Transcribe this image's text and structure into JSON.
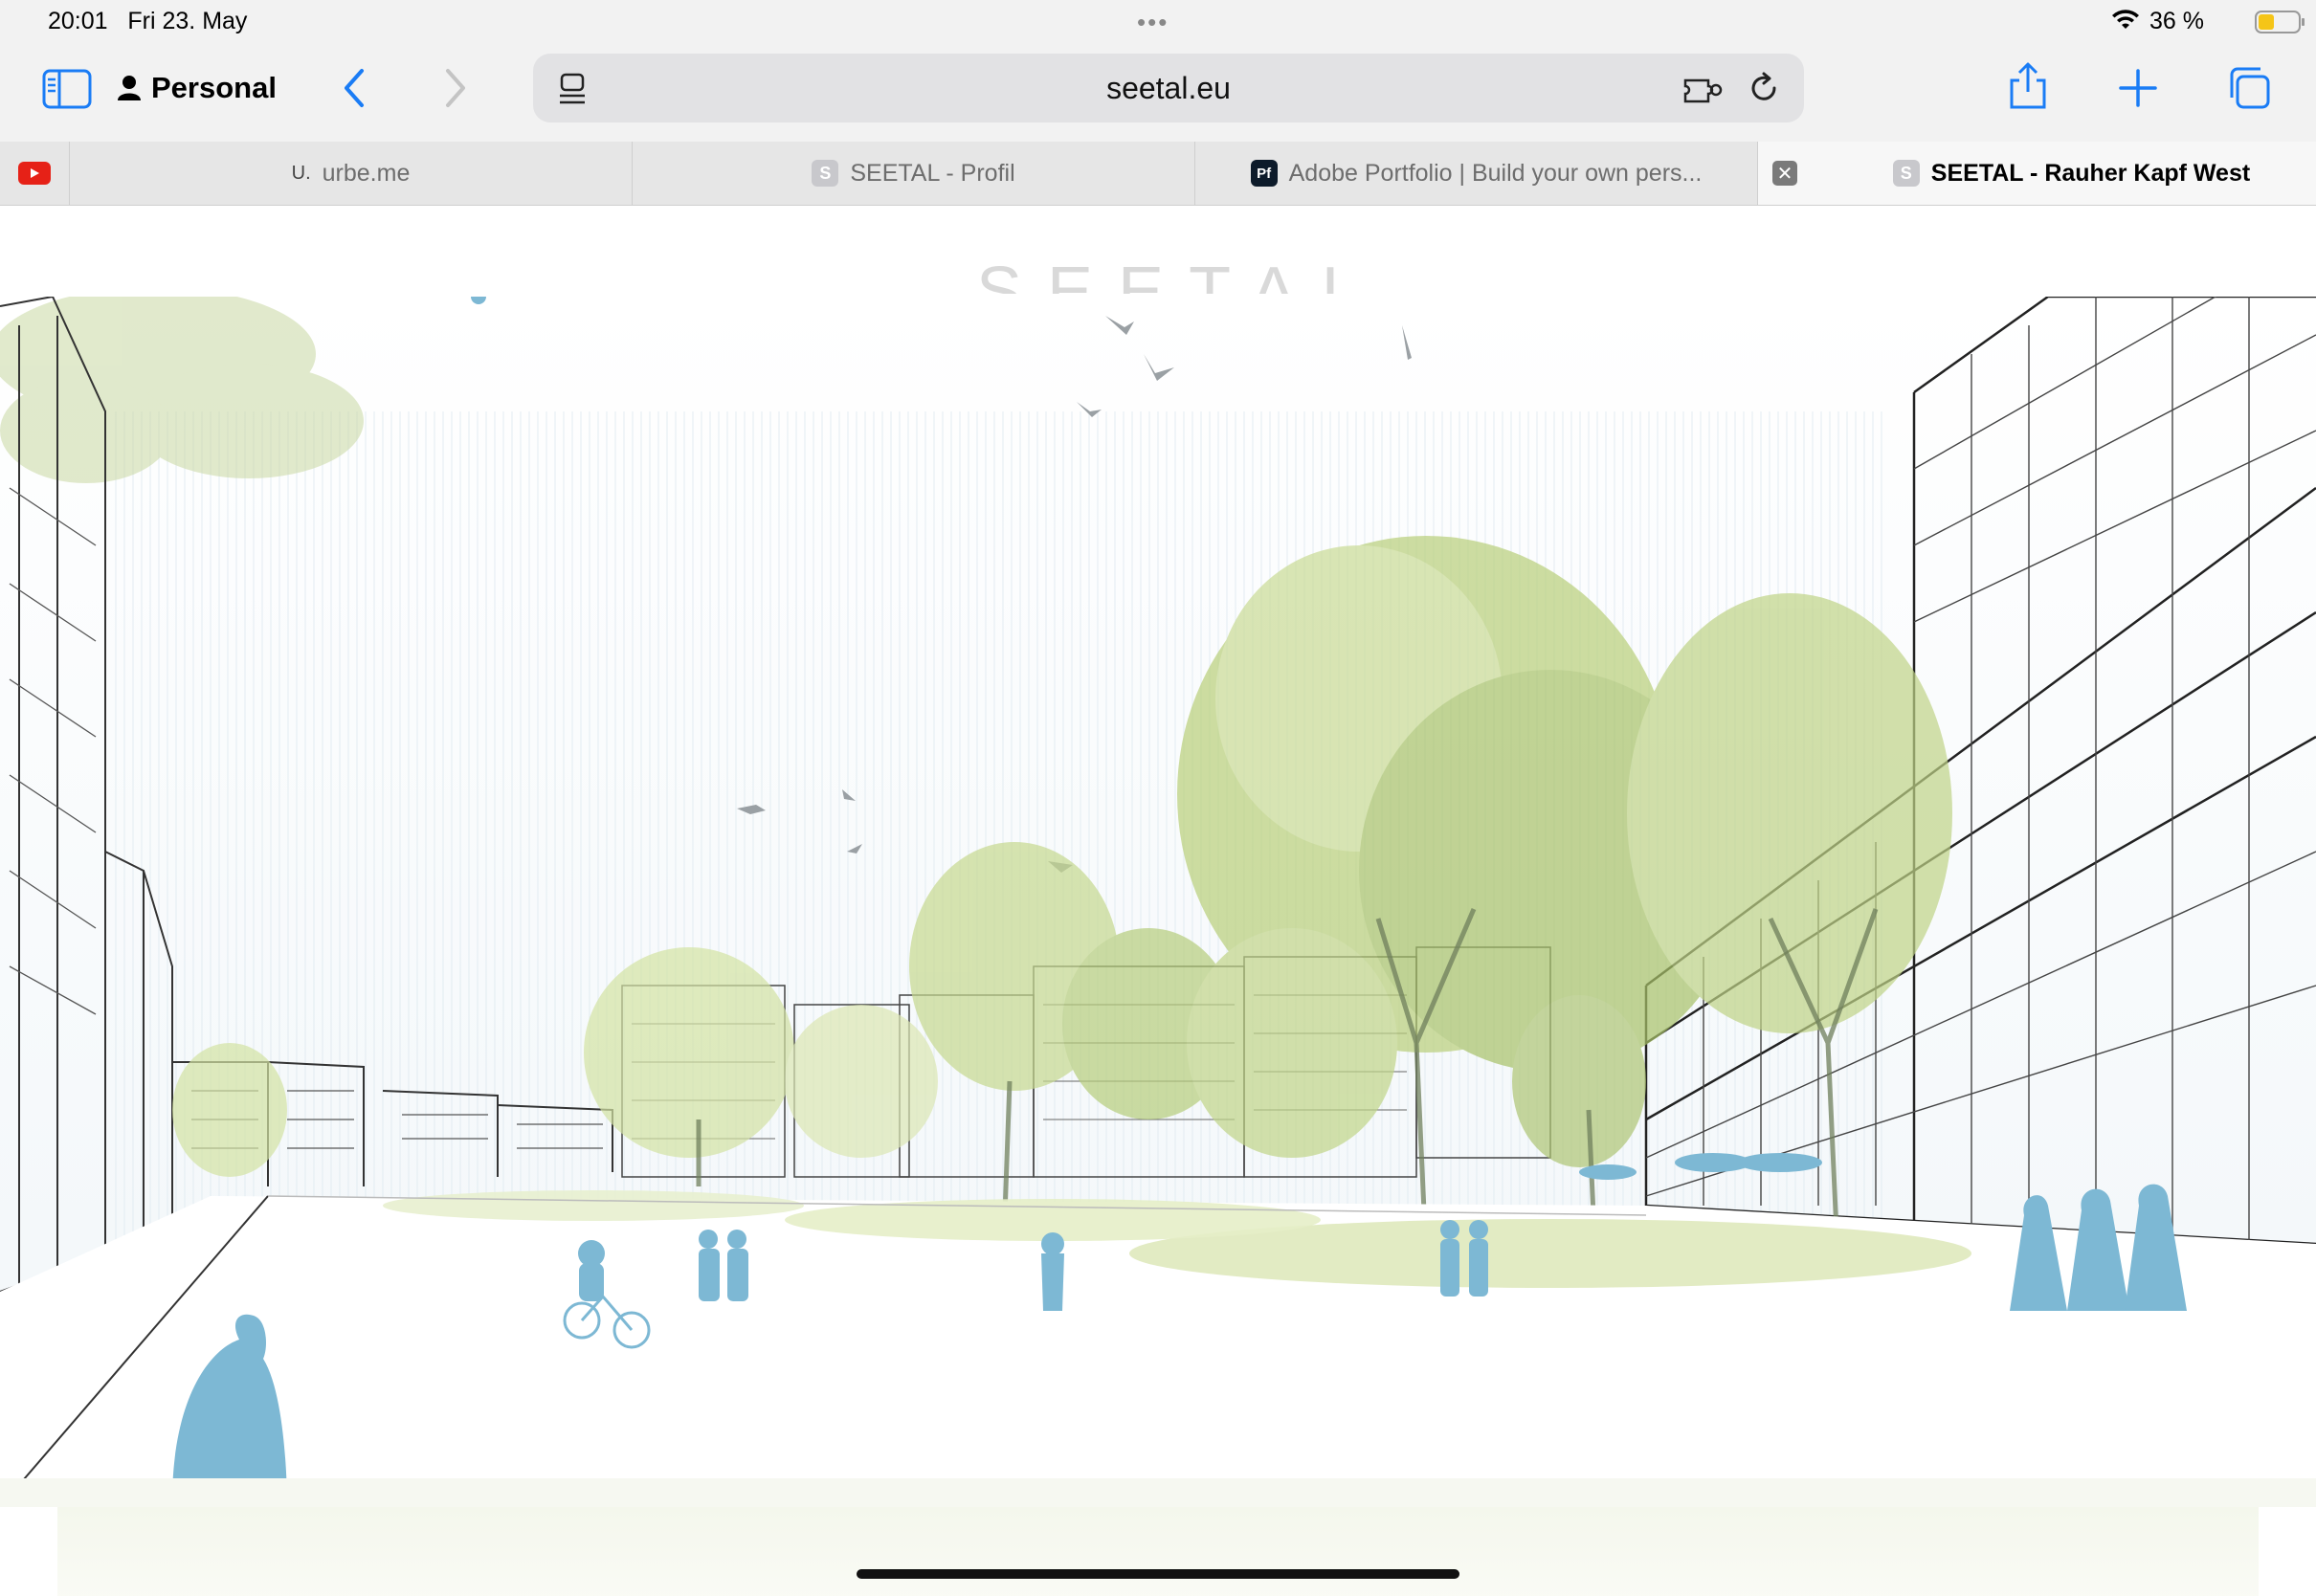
{
  "status_bar": {
    "time": "20:01",
    "date": "Fri 23. May",
    "battery": "36 %"
  },
  "toolbar": {
    "profile_label": "Personal",
    "url": "seetal.eu"
  },
  "tabs": [
    {
      "label": "",
      "icon": "youtube-icon"
    },
    {
      "label": "urbe.me",
      "icon": "urbe-icon"
    },
    {
      "label": "SEETAL - Profil",
      "icon": "seetal-icon"
    },
    {
      "label": "Adobe Portfolio | Build your own pers...",
      "icon": "adobe-portfolio-icon"
    },
    {
      "label": "SEETAL - Rauher Kapf West",
      "icon": "seetal-icon",
      "active": true
    }
  ],
  "page": {
    "logo_text": "SEETAL"
  },
  "colors": {
    "chrome_bg": "#f2f2f2",
    "accent_blue": "#1a7cf5",
    "foliage": "#b9cf7a",
    "figure_blue": "#7db8d4"
  }
}
